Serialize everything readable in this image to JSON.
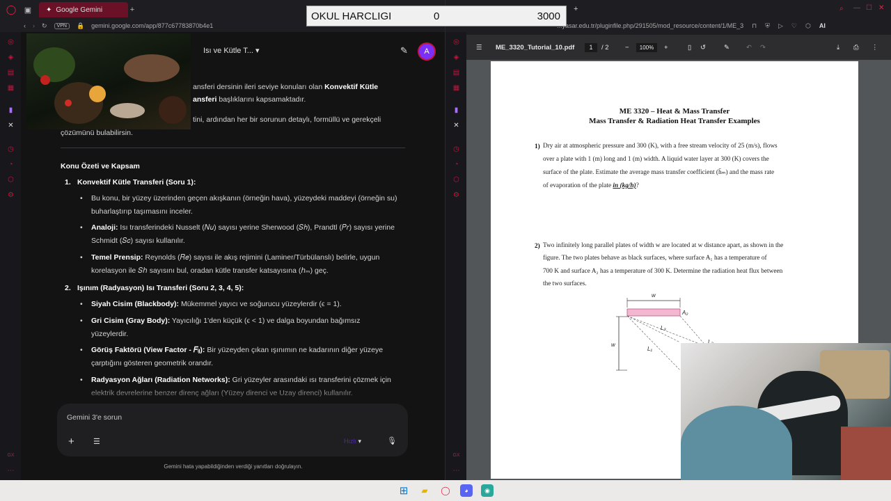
{
  "left_browser": {
    "tab_title": "Google Gemini",
    "url": "gemini.google.com/app/877c67783870b4e1",
    "vpn_label": "VPN",
    "chat_title": "Isı ve Kütle T...",
    "avatar_letter": "A",
    "intro_line1_a": "ansferi dersinin ileri seviye konuları olan ",
    "intro_line1_b": "Konvektif Kütle",
    "intro_line2_a": "ansferi",
    "intro_line2_b": " başlıklarını kapsamaktadır.",
    "intro_line3": "tini, ardından her bir sorunun detaylı, formüllü ve gerekçeli",
    "intro_line4": "çözümünü bulabilirsin.",
    "section_title": "Konu Özeti ve Kapsam",
    "item1_num": "1.",
    "item1_title": "Konvektif Kütle Transferi (Soru 1):",
    "b1": "Bu konu, bir yüzey üzerinden geçen akışkanın (örneğin hava), yüzeydeki maddeyi (örneğin su) buharlaştırıp taşımasını inceler.",
    "b2_bold": "Analoji:",
    "b2": " Isı transferindeki Nusselt (𝑁𝑢) sayısı yerine Sherwood (𝑆ℎ), Prandtl (𝑃𝑟) sayısı yerine Schmidt (𝑆𝑐) sayısı kullanılır.",
    "b3_bold": "Temel Prensip:",
    "b3": " Reynolds (𝑅𝑒) sayısı ile akış rejimini (Laminer/Türbülanslı) belirle, uygun korelasyon ile 𝑆ℎ sayısını bul, oradan kütle transfer katsayısına (ℎₘ) geç.",
    "item2_num": "2.",
    "item2_title": "Işınım (Radyasyon) Isı Transferi (Soru 2, 3, 4, 5):",
    "b4_bold": "Siyah Cisim (Blackbody):",
    "b4": " Mükemmel yayıcı ve soğurucu yüzeylerdir (ϵ = 1).",
    "b5_bold": "Gri Cisim (Gray Body):",
    "b5": " Yayıcılığı 1'den küçük (ϵ < 1) ve dalga boyundan bağımsız yüzeylerdir.",
    "b6_bold": "Görüş Faktörü (View Factor - 𝐹ᵢⱼ):",
    "b6": " Bir yüzeyden çıkan ışınımın ne kadarının diğer yüzeye çarptığını gösteren geometrik orandır.",
    "b7_bold": "Radyasyon Ağları (Radiation Networks):",
    "b7": " Gri yüzeyler arasındaki ısı transferini çözmek için elektrik devrelerine benzer direnç ağları (Yüzey direnci ve Uzay direnci) kullanılır.",
    "input_placeholder": "Gemini 3'e sorun",
    "model_label": "Hızlı",
    "disclaimer": "Gemini hata yapabildiğinden verdiği yanıtları doğrulayın."
  },
  "overlay": {
    "label": "OKUL HARCLIGI",
    "value1": "0",
    "value2": "3000"
  },
  "right_browser": {
    "url": "...yasar.edu.tr/pluginfile.php/291505/mod_resource/content/1/ME_3",
    "ai_label": "AI",
    "pdf_title": "ME_3320_Tutorial_10.pdf",
    "page_current": "1",
    "page_total": "/ 2",
    "zoom": "100%",
    "heading1": "ME 3320 – Heat & Mass Transfer",
    "heading2": "Mass Transfer & Radiation Heat Transfer Examples",
    "q1_num": "1)",
    "q1_l1": "Dry air at atmospheric pressure and 300 (K), with a free stream velocity of 25 (m/s), flows",
    "q1_l2": "over a plate with 1 (m) long and 1 (m) width. A liquid water layer at 300 (K) covers the",
    "q1_l3": "surface of the plate. Estimate the average mass transfer coefficient (h̄ₘ) and the mass rate",
    "q1_l4": "of evaporation of the plate ",
    "q1_unit": "in (kg/h)",
    "q1_end": "?",
    "q2_num": "2)",
    "q2_l1": "Two infinitely long parallel plates of width w are located at w distance apart, as shown in the",
    "q2_l2": "figure. The two plates behave as black surfaces, where surface A₁ has a temperature of",
    "q2_l3": "700 K and surface A₂ has a temperature of 300 K. Determine the radiation heat flux between",
    "q2_l4": "the two surfaces.",
    "fig_w_top": "w",
    "fig_w_side": "w",
    "fig_a2": "A₂",
    "fig_l1": "L₁",
    "fig_l2": "L₂",
    "fig_l3": "L₃"
  }
}
